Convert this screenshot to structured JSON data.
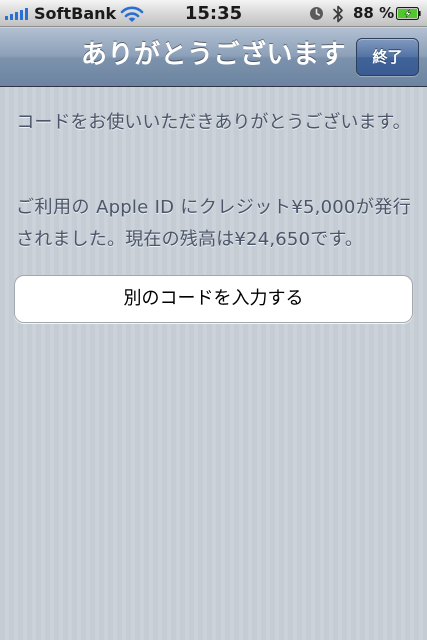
{
  "status_bar": {
    "carrier": "SoftBank",
    "time": "15:35",
    "battery_percent": "88 %",
    "signal_bars": 5,
    "battery_level": 0.88,
    "icons": [
      "signal-bars-icon",
      "wifi-icon",
      "alarm-clock-icon",
      "bluetooth-icon",
      "battery-charging-icon"
    ]
  },
  "nav_bar": {
    "title": "ありがとうございます",
    "done_label": "終了"
  },
  "content": {
    "thanks_message": "コードをお使いいただきありがとうございます。",
    "credit_message": "ご利用の Apple ID にクレジット¥5,000が発行されました。現在の残高は¥24,650です。",
    "redeem_another_label": "別のコードを入力する"
  },
  "colors": {
    "nav_bar": "#7c92ac",
    "done_button": "#4a6aa0",
    "background": "#c5ccd4",
    "signal": "#2a6fd3",
    "battery_fill": "#4fc829",
    "body_text": "#4c566a"
  }
}
